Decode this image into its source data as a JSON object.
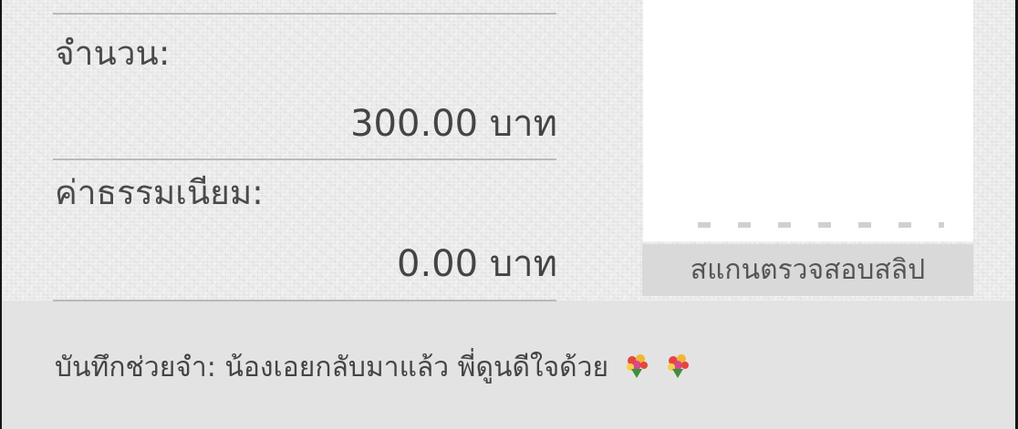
{
  "amount": {
    "label": "จำนวน:",
    "value": "300.00 บาท"
  },
  "fee": {
    "label": "ค่าธรรมเนียม:",
    "value": "0.00 บาท"
  },
  "qr": {
    "scan_button_label": "สแกนตรวจสอบสลิป"
  },
  "memo": {
    "text": "บันทึกช่วยจำ: น้องเอยกลับมาแล้ว พี่ดูนดีใจด้วย",
    "emoji_icons": [
      "bouquet-icon",
      "bouquet-icon"
    ]
  },
  "colors": {
    "background": "#ebebeb",
    "memo_band": "#e3e3e3",
    "text": "#444444",
    "divider": "#b9b9b9",
    "button_bg": "#d9d9d9"
  }
}
